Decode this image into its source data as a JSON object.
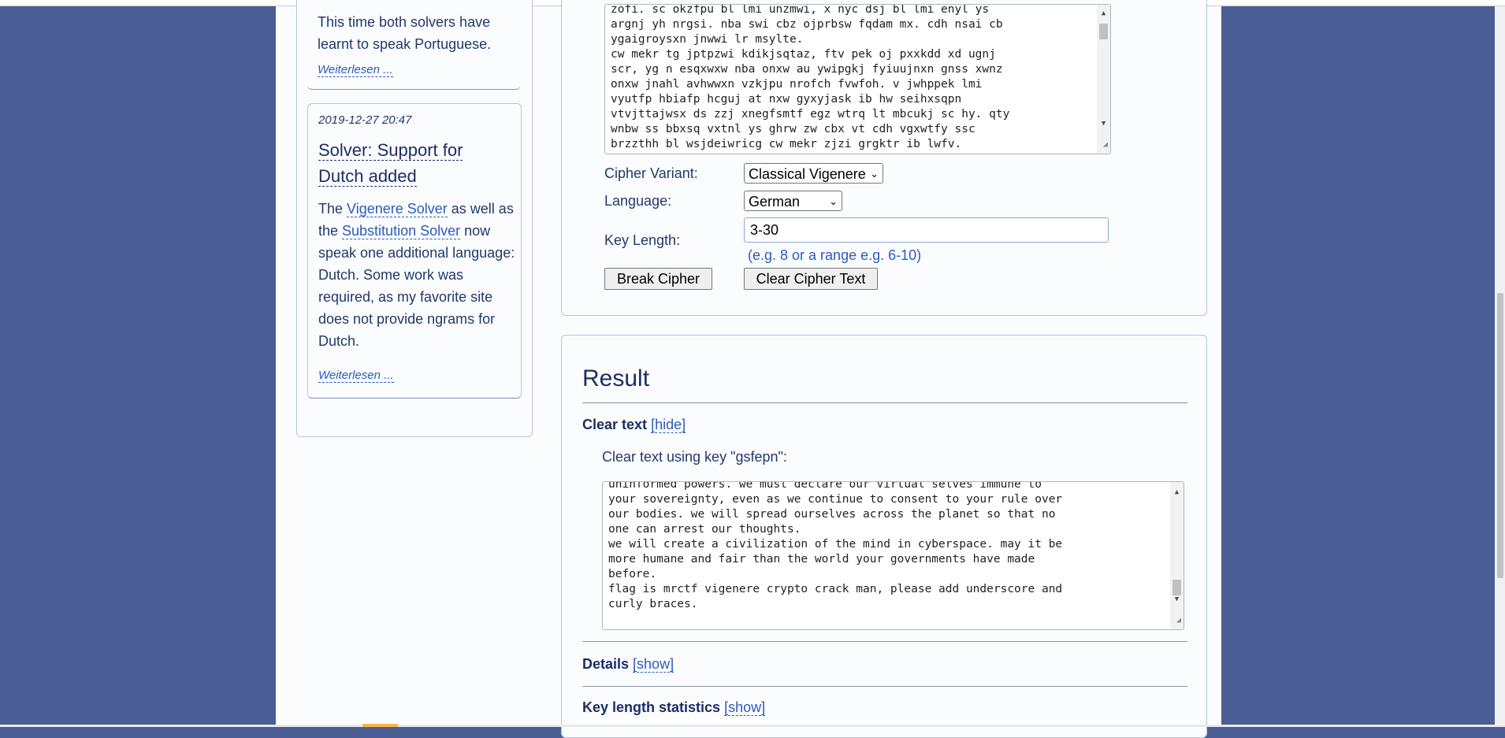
{
  "sidebar": {
    "post1": {
      "text": "This time both solvers have learnt to speak Portuguese.",
      "read_more": "Weiterlesen ..."
    },
    "post2": {
      "date": "2019-12-27 20:47",
      "title": "Solver: Support for Dutch added",
      "text_1": "The ",
      "link_vigenere": "Vigenere Solver",
      "text_2": " as well as the ",
      "link_substitution": "Substitution Solver",
      "text_3": " now speak one additional language: Dutch. Some work was required, as my favorite site does not provide ngrams for Dutch.",
      "read_more": "Weiterlesen ..."
    }
  },
  "form": {
    "cipher_text_lines": [
      "zofi. sc okzfpu bl lmi unzmwi, x nyc dsj bl lmi enyl ys",
      "argnj yh nrgsi. nba swi cbz ojprbsw fqdam mx. cdh nsai cb",
      "ygaigroysxn jnwwi lr msylte.",
      "cw mekr tg jptpzwi kdikjsqtaz, ftv pek oj pxxkdd xd ugnj",
      "scr, yg n esqxwxw nba onxw au ywipgkj fyiuujnxn gnss xwnz",
      "onxw jnahl avhwwxn vzkjpu nrofch fvwfoh. v jwhppek lmi",
      "vyutfp hbiafp hcguj at nxw gyxyjask ib hw seihxsqpn",
      "vtvjttajwsx ds zzj xnegfsmtf egz wtrq lt mbcukj sc hy. qty",
      "wnbw ss bbxsq vxtnl ys ghrw zw cbx vt cdh vgxwtfy ssc",
      "brzzthh bl wsjdeiwricg cw mekr zjzi grgktr ib lwfv."
    ],
    "cipher_variant_label": "Cipher Variant:",
    "cipher_variant_value": "Classical Vigenere",
    "language_label": "Language:",
    "language_value": "German",
    "key_length_label": "Key Length:",
    "key_length_value": "3-30",
    "key_length_hint": "(e.g. 8 or a range e.g. 6-10)",
    "break_button": "Break Cipher",
    "clear_button": "Clear Cipher Text"
  },
  "result": {
    "title": "Result",
    "clear_text_label": "Clear text",
    "clear_text_toggle": "[hide]",
    "key_line": "Clear text using key \"gsfepn\":",
    "clear_text_lines": [
      "uninformed powers. we must declare our virtual selves immune to",
      "your sovereignty, even as we continue to consent to your rule over",
      "our bodies. we will spread ourselves across the planet so that no",
      "one can arrest our thoughts.",
      "we will create a civilization of the mind in cyberspace. may it be",
      "more humane and fair than the world your governments have made",
      "before.",
      "flag is mrctf vigenere crypto crack man, please add underscore and",
      "curly braces."
    ],
    "details_label": "Details",
    "details_toggle": "[show]",
    "stats_label": "Key length statistics",
    "stats_toggle": "[show]"
  },
  "colors": {
    "background": "#4a5e95",
    "panel": "#fbfcfe",
    "heading": "#1b2f65",
    "link": "#2a5bbd"
  }
}
